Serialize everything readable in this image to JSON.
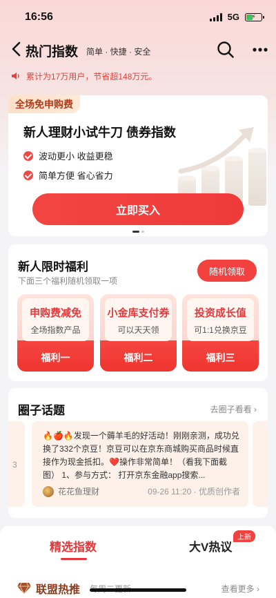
{
  "status": {
    "time": "16:56",
    "network": "5G"
  },
  "header": {
    "title": "热门指数",
    "subtitle": "简单 · 快捷 · 安全",
    "icons": [
      "back-icon",
      "search-icon",
      "more-icon"
    ]
  },
  "notice": {
    "text": "累计为17万用户，节省超148万元。",
    "icon": "speaker-icon"
  },
  "promo": {
    "tag": "全场免申购费",
    "title": "新人理财小试牛刀 债券指数",
    "features": [
      "波动更小 收益更稳",
      "简单方便 省心省力"
    ],
    "button": "立即买入"
  },
  "benefits": {
    "title": "新人限时福利",
    "subtitle": "下面三个福利随机领取一项",
    "button": "随机领取",
    "coupons": [
      {
        "title": "申购费减免",
        "desc": "全场指数产品",
        "name": "福利一"
      },
      {
        "title": "小金库支付券",
        "desc": "可以天天领",
        "name": "福利二"
      },
      {
        "title": "投资成长值",
        "desc": "可1:1兑换京豆",
        "name": "福利三"
      }
    ]
  },
  "topics": {
    "title": "圈子话题",
    "more": "去圈子看看",
    "prev_fragment": "3",
    "post": {
      "text": "🔥🍎🔥发现一个薅羊毛的好活动！刚刚亲测，成功兑换了332个京豆！京豆可以在京东商城购买商品时候直接作为现金抵扣。❤️操作非常简单！（看我下面截图） 1、参与方式： 打开京东金融app搜索...",
      "author": "花花鱼理财",
      "meta": "09-26 11:20 · 优质创作者"
    }
  },
  "tabs": {
    "items": [
      "精选指数",
      "大V热议"
    ],
    "badge": "上新",
    "active": "精选指数"
  },
  "league": {
    "title": "联盟热推",
    "subtitle": "每周二更新",
    "more": "查看更多"
  },
  "colors": {
    "accent": "#f2413e",
    "brand_text": "#e6383a"
  }
}
